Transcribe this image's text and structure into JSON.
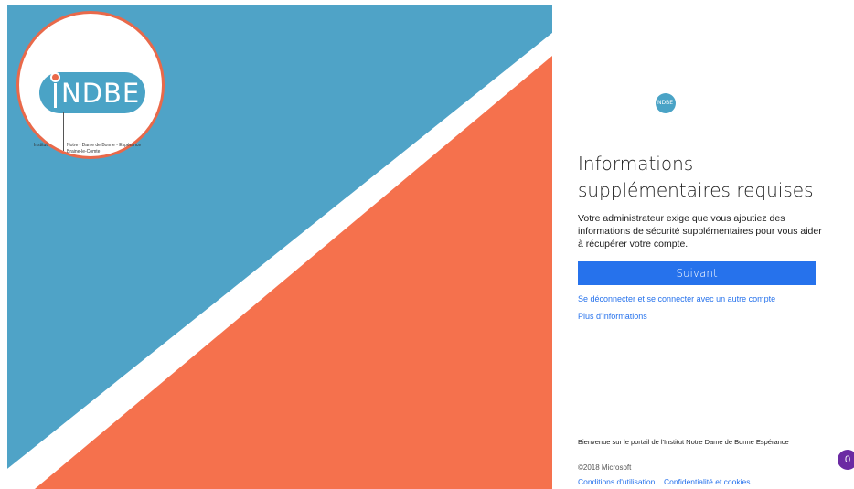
{
  "brand": {
    "logo_word": "NDBE",
    "logo_institute": "Institut",
    "logo_name_line1": "Notre - Dame de Bonne - Espérance",
    "logo_name_line2": "Braine-le-Comte",
    "mini_logo_text": "NDBE",
    "colors": {
      "blue": "#4aa3c6",
      "orange": "#f5714d",
      "accent": "#2672ec"
    }
  },
  "main": {
    "title": "Informations supplémentaires requises",
    "description": "Votre administrateur exige que vous ajoutiez des informations de sécurité supplémentaires pour vous aider à récupérer votre compte.",
    "next_label": "Suivant",
    "switch_account_link": "Se déconnecter et se connecter avec un autre compte",
    "more_info_link": "Plus d'informations"
  },
  "footer": {
    "portal_text": "Bienvenue sur le portail de l'Institut Notre Dame de Bonne Espérance",
    "copyright": "©2018 Microsoft",
    "terms": "Conditions d'utilisation",
    "privacy": "Confidentialité et cookies"
  },
  "badge": {
    "count": "0"
  }
}
